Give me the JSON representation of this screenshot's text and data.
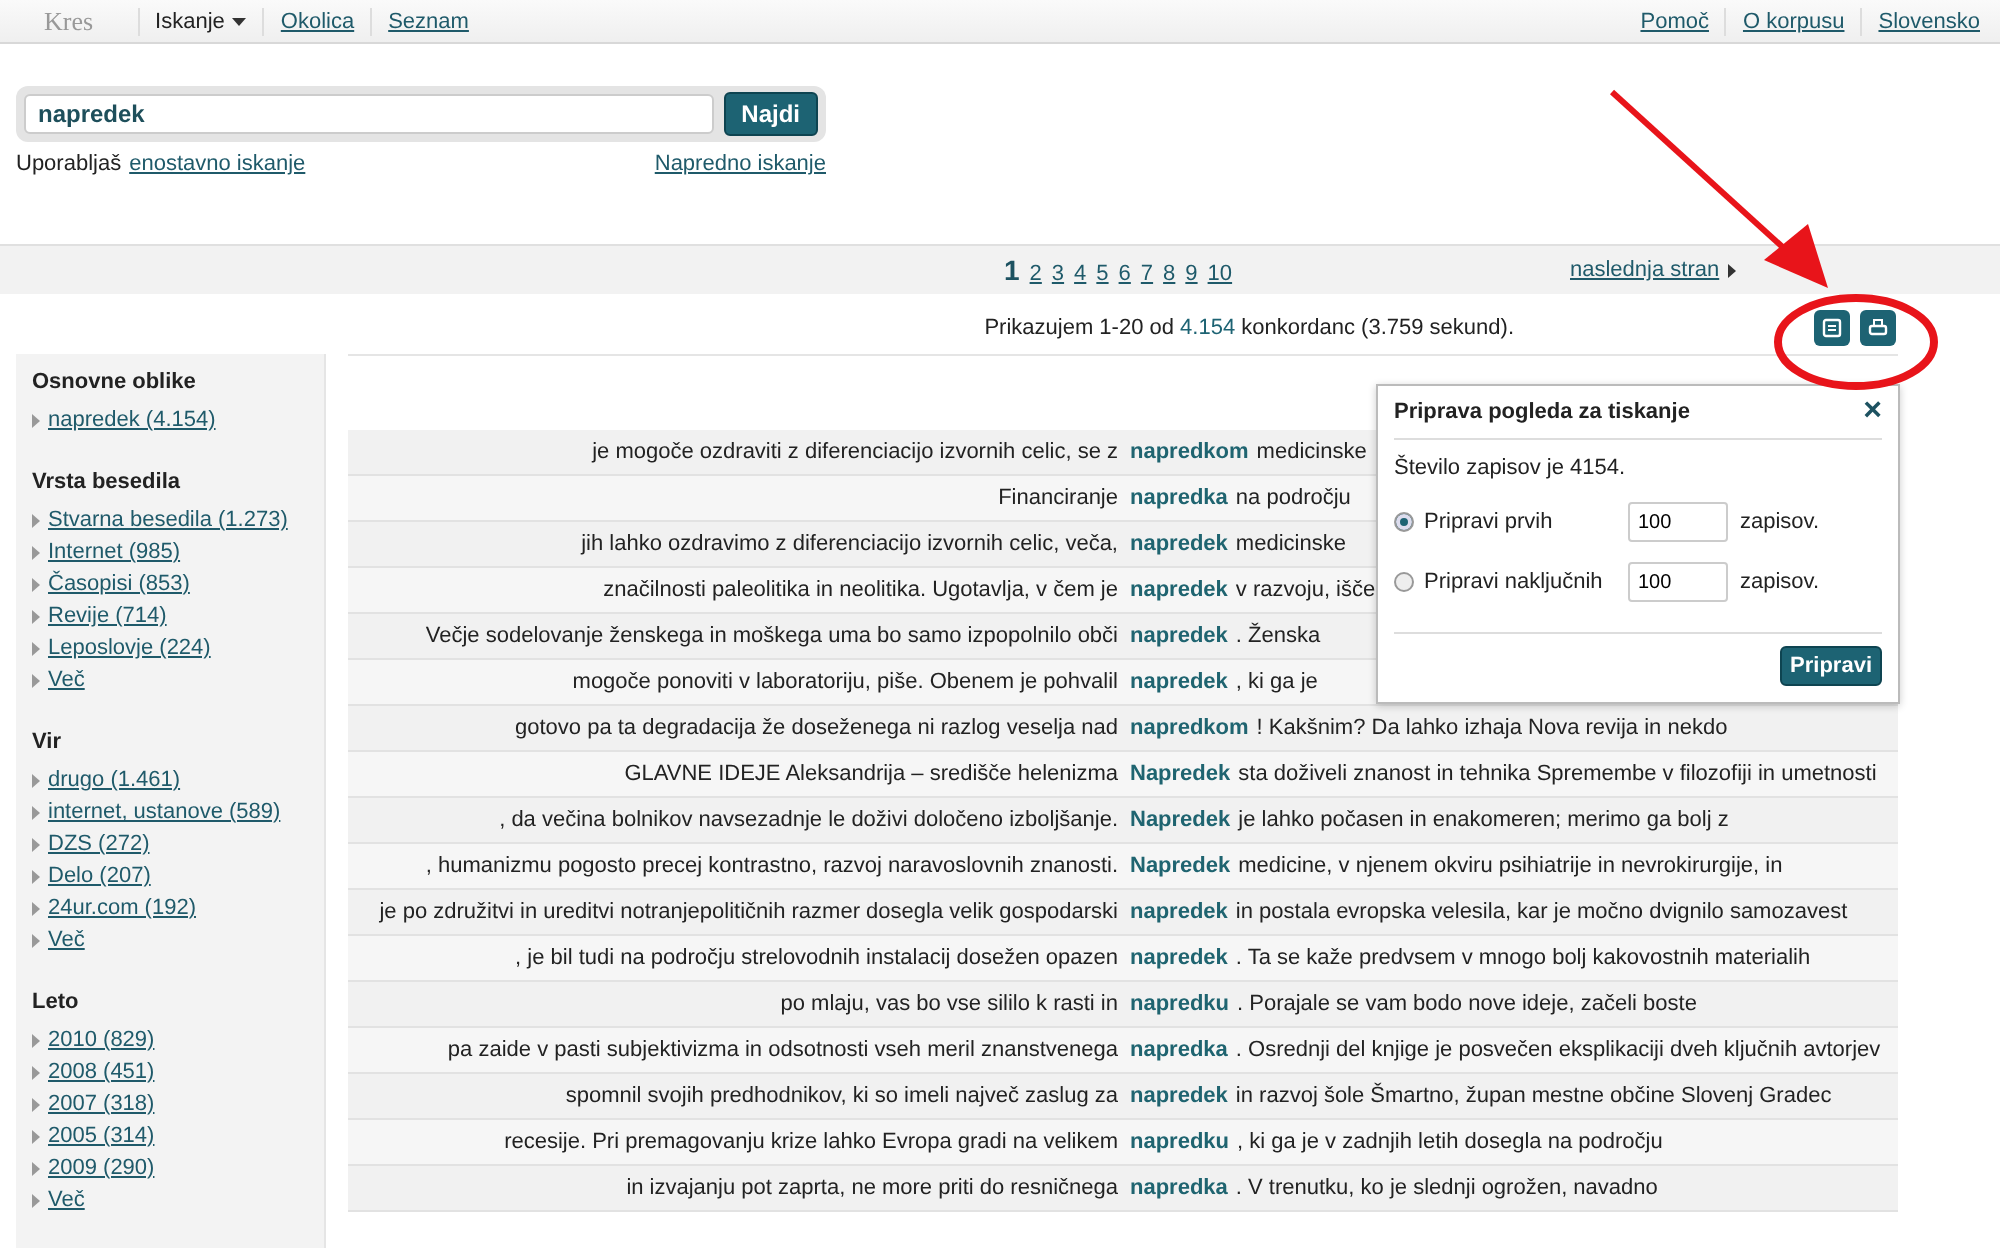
{
  "topbar": {
    "logo": "Kres",
    "nav": [
      {
        "label": "Iskanje",
        "kind": "menu",
        "selected": true
      },
      {
        "label": "Okolica",
        "kind": "link",
        "selected": false
      },
      {
        "label": "Seznam",
        "kind": "link",
        "selected": false
      }
    ],
    "right_links": [
      "Pomoč",
      "O korpusu",
      "Slovensko"
    ]
  },
  "search": {
    "value": "napredek",
    "button": "Najdi",
    "mode_prefix": "Uporabljaš",
    "mode_link": "enostavno iskanje",
    "advanced_link": "Napredno iskanje"
  },
  "pagination": {
    "pages": [
      {
        "label": "1",
        "selected": true
      },
      {
        "label": "2",
        "selected": false
      },
      {
        "label": "3",
        "selected": false
      },
      {
        "label": "4",
        "selected": false
      },
      {
        "label": "5",
        "selected": false
      },
      {
        "label": "6",
        "selected": false
      },
      {
        "label": "7",
        "selected": false
      },
      {
        "label": "8",
        "selected": false
      },
      {
        "label": "9",
        "selected": false
      },
      {
        "label": "10",
        "selected": false
      }
    ],
    "next": "naslednja stran"
  },
  "summary": {
    "prefix": "Prikazujem 1-20 od",
    "count": "4.154",
    "suffix": "konkordanc (3.759 sekund)."
  },
  "sidebar": [
    {
      "title": "Osnovne oblike",
      "items": [
        "napredek (4.154)"
      ]
    },
    {
      "title": "Vrsta besedila",
      "items": [
        "Stvarna besedila (1.273)",
        "Internet (985)",
        "Časopisi (853)",
        "Revije (714)",
        "Leposlovje (224)",
        "Več"
      ]
    },
    {
      "title": "Vir",
      "items": [
        "drugo (1.461)",
        "internet, ustanove (589)",
        "DZS (272)",
        "Delo (207)",
        "24ur.com (192)",
        "Več"
      ]
    },
    {
      "title": "Leto",
      "items": [
        "2010 (829)",
        "2008 (451)",
        "2007 (318)",
        "2005 (314)",
        "2009 (290)",
        "Več"
      ]
    }
  ],
  "rows": [
    {
      "left": "je mogoče ozdraviti z diferenciacijo izvornih celic, se z",
      "keyword": "napredkom",
      "right": "medicinske"
    },
    {
      "left": "Financiranje",
      "keyword": "napredka",
      "right": "na področju"
    },
    {
      "left": "jih lahko ozdravimo z diferenciacijo izvornih celic, veča,",
      "keyword": "napredek",
      "right": "medicinske"
    },
    {
      "left": "značilnosti paleolitika in neolitika. Ugotavlja, v čem je",
      "keyword": "napredek",
      "right": "v razvoju, išče"
    },
    {
      "left": "Večje sodelovanje ženskega in moškega uma bo samo izpopolnilo obči",
      "keyword": "napredek",
      "right": ". Ženska"
    },
    {
      "left": "mogoče ponoviti v laboratoriju, piše. Obenem je pohvalil",
      "keyword": "napredek",
      "right": ", ki ga je"
    },
    {
      "left": "gotovo pa ta degradacija že doseženega ni razlog veselja nad",
      "keyword": "napredkom",
      "right": "! Kakšnim? Da lahko izhaja Nova revija in nekdo"
    },
    {
      "left": "GLAVNE IDEJE Aleksandrija – središče helenizma",
      "keyword": "Napredek",
      "right": "sta doživeli znanost in tehnika Spremembe v filozofiji in umetnosti"
    },
    {
      "left": ", da večina bolnikov navsezadnje le doživi določeno izboljšanje.",
      "keyword": "Napredek",
      "right": "je lahko počasen in enakomeren; merimo ga bolj z"
    },
    {
      "left": ", humanizmu pogosto precej kontrastno, razvoj naravoslovnih znanosti.",
      "keyword": "Napredek",
      "right": "medicine, v njenem okviru psihiatrije in nevrokirurgije, in"
    },
    {
      "left": "je po združitvi in ureditvi notranjepolitičnih razmer dosegla velik gospodarski",
      "keyword": "napredek",
      "right": "in postala evropska velesila, kar je močno dvignilo samozavest"
    },
    {
      "left": ", je bil tudi na področju strelovodnih instalacij dosežen opazen",
      "keyword": "napredek",
      "right": ". Ta se kaže predvsem v mnogo bolj kakovostnih materialih"
    },
    {
      "left": "po mlaju, vas bo vse sililo k rasti in",
      "keyword": "napredku",
      "right": ". Porajale se vam bodo nove ideje, začeli boste"
    },
    {
      "left": "pa zaide v pasti subjektivizma in odsotnosti vseh meril znanstvenega",
      "keyword": "napredka",
      "right": ". Osrednji del knjige je posvečen eksplikaciji dveh ključnih avtorjev"
    },
    {
      "left": "spomnil svojih predhodnikov, ki so imeli največ zaslug za",
      "keyword": "napredek",
      "right": "in razvoj šole Šmartno, župan mestne občine Slovenj Gradec"
    },
    {
      "left": "recesije. Pri premagovanju krize lahko Evropa gradi na velikem",
      "keyword": "napredku",
      "right": ", ki ga je v zadnjih letih dosegla na področju"
    },
    {
      "left": "in izvajanju pot zaprta, ne more priti do resničnega",
      "keyword": "napredka",
      "right": ". V trenutku, ko je slednji ogrožen, navadno"
    }
  ],
  "print_dialog": {
    "title": "Priprava pogleda za tiskanje",
    "close": "×",
    "info": "Število zapisov je 4154.",
    "options": [
      {
        "label": "Pripravi prvih",
        "value": "100",
        "unit": "zapisov.",
        "selected": true
      },
      {
        "label": "Pripravi naključnih",
        "value": "100",
        "unit": "zapisov.",
        "selected": false
      }
    ],
    "button": "Pripravi"
  }
}
